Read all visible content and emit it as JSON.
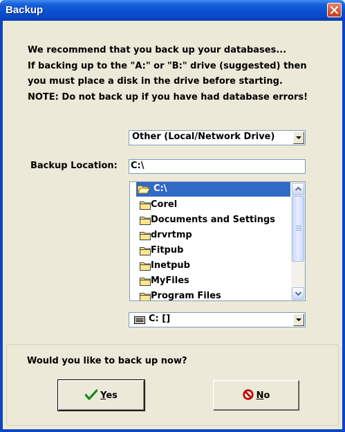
{
  "window": {
    "title": "Backup"
  },
  "message": {
    "lines": [
      "We recommend that you back up your databases...",
      "If backing up to the \"A:\" or \"B:\" drive (suggested) then",
      "you must place a disk in the drive before starting.",
      "NOTE: Do not back up if you have had database errors!"
    ]
  },
  "destination_select": {
    "value": "Other (Local/Network Drive)"
  },
  "backup_location": {
    "label": "Backup Location:",
    "value": "C:\\"
  },
  "folders": {
    "selected": "C:\\",
    "items": [
      "Corel",
      "Documents and Settings",
      "drvrtmp",
      "Fitpub",
      "Inetpub",
      "MyFiles",
      "Program Files"
    ]
  },
  "drive_select": {
    "value": "C: []"
  },
  "prompt": {
    "question": "Would you like to back up now?"
  },
  "buttons": {
    "yes": {
      "mnemonic": "Y",
      "rest": "es"
    },
    "no": {
      "mnemonic": "N",
      "rest": "o"
    }
  },
  "colors": {
    "titlebar": "#0a46c4",
    "selection": "#316ac5",
    "face": "#ece9d8"
  },
  "icons": [
    "close-icon",
    "open-folder-icon",
    "folder-icon",
    "drive-icon",
    "checkmark-icon",
    "no-sign-icon",
    "scroll-up-icon",
    "scroll-down-icon",
    "dropdown-arrow-icon"
  ]
}
